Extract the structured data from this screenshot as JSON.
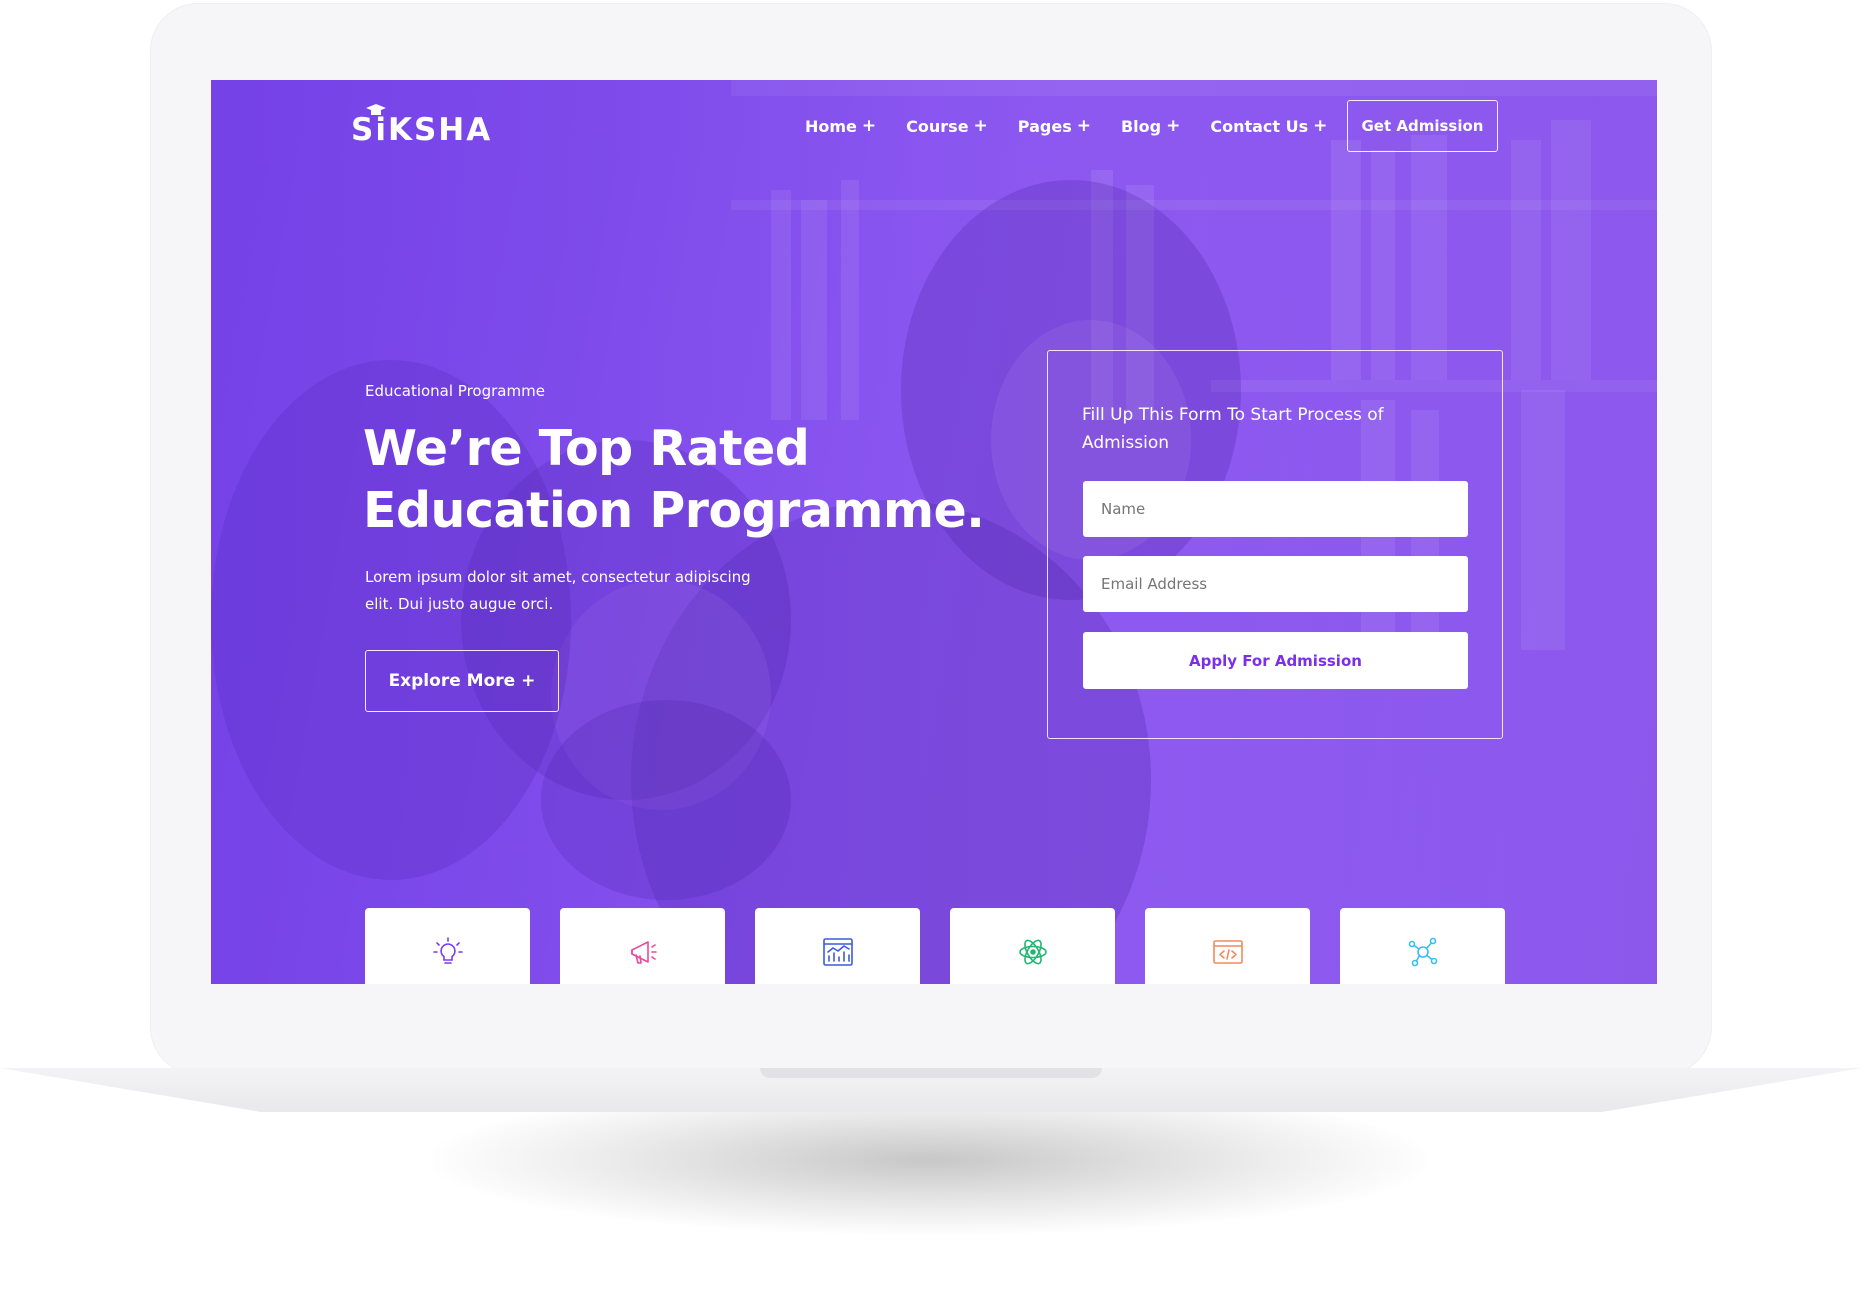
{
  "brand": {
    "name": "SiKSHA"
  },
  "nav": {
    "items": [
      {
        "label": "Home",
        "suffix": "+"
      },
      {
        "label": "Course",
        "suffix": "+"
      },
      {
        "label": "Pages",
        "suffix": "+"
      },
      {
        "label": "Blog",
        "suffix": "+"
      },
      {
        "label": "Contact Us",
        "suffix": "+"
      }
    ],
    "cta_label": "Get Admission"
  },
  "hero": {
    "eyebrow": "Educational Programme",
    "title_line1": "We’re Top Rated",
    "title_line2": "Education Programme.",
    "description_line1": "Lorem ipsum dolor sit amet, consectetur adipiscing",
    "description_line2": "elit. Dui justo augue orci.",
    "button_label": "Explore More",
    "button_suffix": "+"
  },
  "form": {
    "title": "Fill Up This Form To Start Process of Admission",
    "name_placeholder": "Name",
    "name_value": "",
    "email_placeholder": "Email Address",
    "email_value": "",
    "submit_label": "Apply For Admission"
  },
  "feature_cards": [
    {
      "icon": "lightbulb-icon",
      "color": "#7c3aed"
    },
    {
      "icon": "megaphone-icon",
      "color": "#ec4899"
    },
    {
      "icon": "analytics-chart-icon",
      "color": "#3b5bdb"
    },
    {
      "icon": "atom-icon",
      "color": "#22b573"
    },
    {
      "icon": "code-window-icon",
      "color": "#f08a5d"
    },
    {
      "icon": "network-molecule-icon",
      "color": "#38bdf8"
    }
  ],
  "colors": {
    "brand_purple": "#7c2fe8",
    "overlay_purple": "#7a45ee",
    "white": "#ffffff"
  }
}
